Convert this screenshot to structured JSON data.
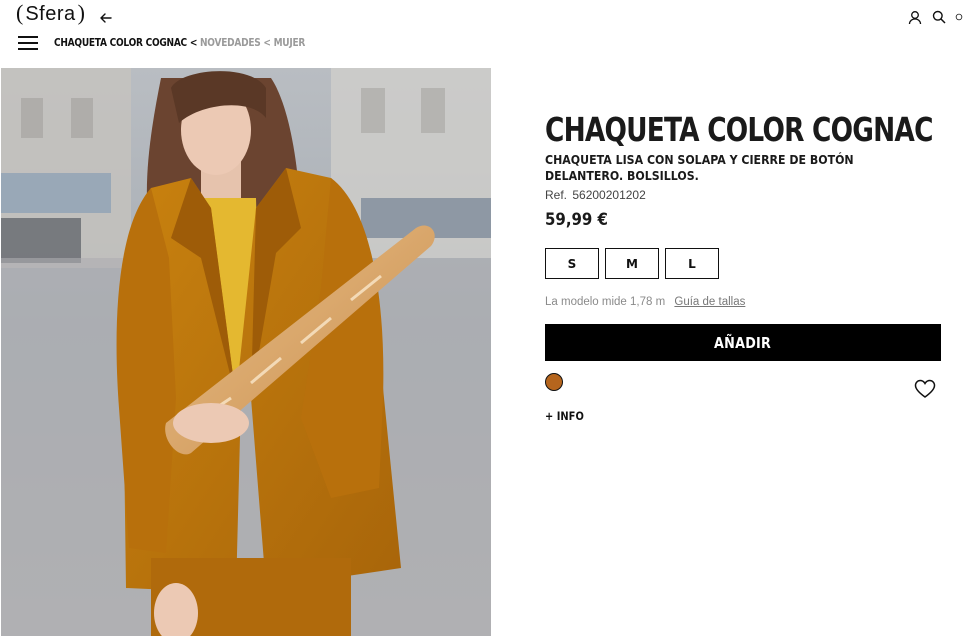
{
  "header": {
    "logo_text": "Sfera",
    "logo_open": "(",
    "logo_close": ")"
  },
  "breadcrumb": {
    "current": "CHAQUETA COLOR COGNAC",
    "separator": "<",
    "items": [
      "NOVEDADES",
      "MUJER"
    ]
  },
  "product": {
    "title": "CHAQUETA COLOR COGNAC",
    "description": "CHAQUETA LISA CON SOLAPA Y CIERRE DE BOTÓN DELANTERO. BOLSILLOS.",
    "ref_label": "Ref.",
    "ref_value": "56200201202",
    "price": "59,99 €",
    "sizes": [
      "S",
      "M",
      "L"
    ],
    "model_note": "La modelo mide 1,78 m",
    "size_guide_label": "Guía de tallas",
    "add_button_label": "AÑADIR",
    "more_info_label": "+ INFO",
    "swatch_color": "#b5651d"
  },
  "icons": {
    "back": "arrow-left-icon",
    "user": "user-icon",
    "search": "search-icon",
    "bag": "bag-icon",
    "menu": "hamburger-menu-icon",
    "wishlist": "heart-icon"
  }
}
